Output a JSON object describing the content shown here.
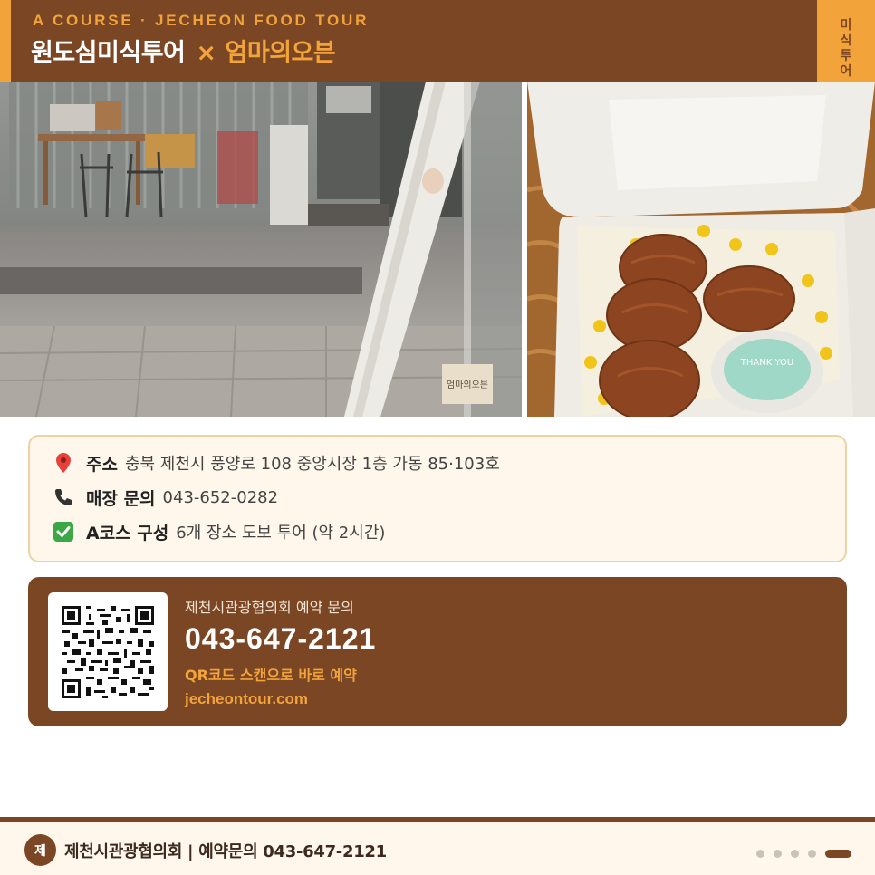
{
  "header": {
    "eyebrow": "A COURSE · JECHEON FOOD TOUR",
    "title_main": "원도심미식투어",
    "title_sep": "×",
    "title_sub": "엄마의오븐",
    "side_tab": "미식투어"
  },
  "photos": {
    "left_sign_text": "엄마의오븐",
    "right_cup_text": "THANK YOU"
  },
  "info": {
    "address": {
      "icon": "pin-icon",
      "label": "주소",
      "value": "충북 제천시 풍양로 108 중앙시장 1층 가동 85·103호"
    },
    "phone": {
      "icon": "phone-icon",
      "label": "매장 문의",
      "value": "043-652-0282"
    },
    "course": {
      "icon": "check-icon",
      "label": "A코스 구성",
      "value": "6개 장소 도보 투어 (약 2시간)"
    }
  },
  "booking": {
    "label": "제천시관광협의회 예약 문의",
    "phone": "043-647-2121",
    "cta": "QR코드 스캔으로 바로 예약",
    "url": "jecheontour.com"
  },
  "footer": {
    "logo_char": "제",
    "text": "제천시관광협의회 | 예약문의 043-647-2121",
    "page_dots": {
      "total": 5,
      "active": 5
    }
  },
  "colors": {
    "brown": "#7b4623",
    "orange": "#f2a33a",
    "cream": "#fff7ec"
  }
}
